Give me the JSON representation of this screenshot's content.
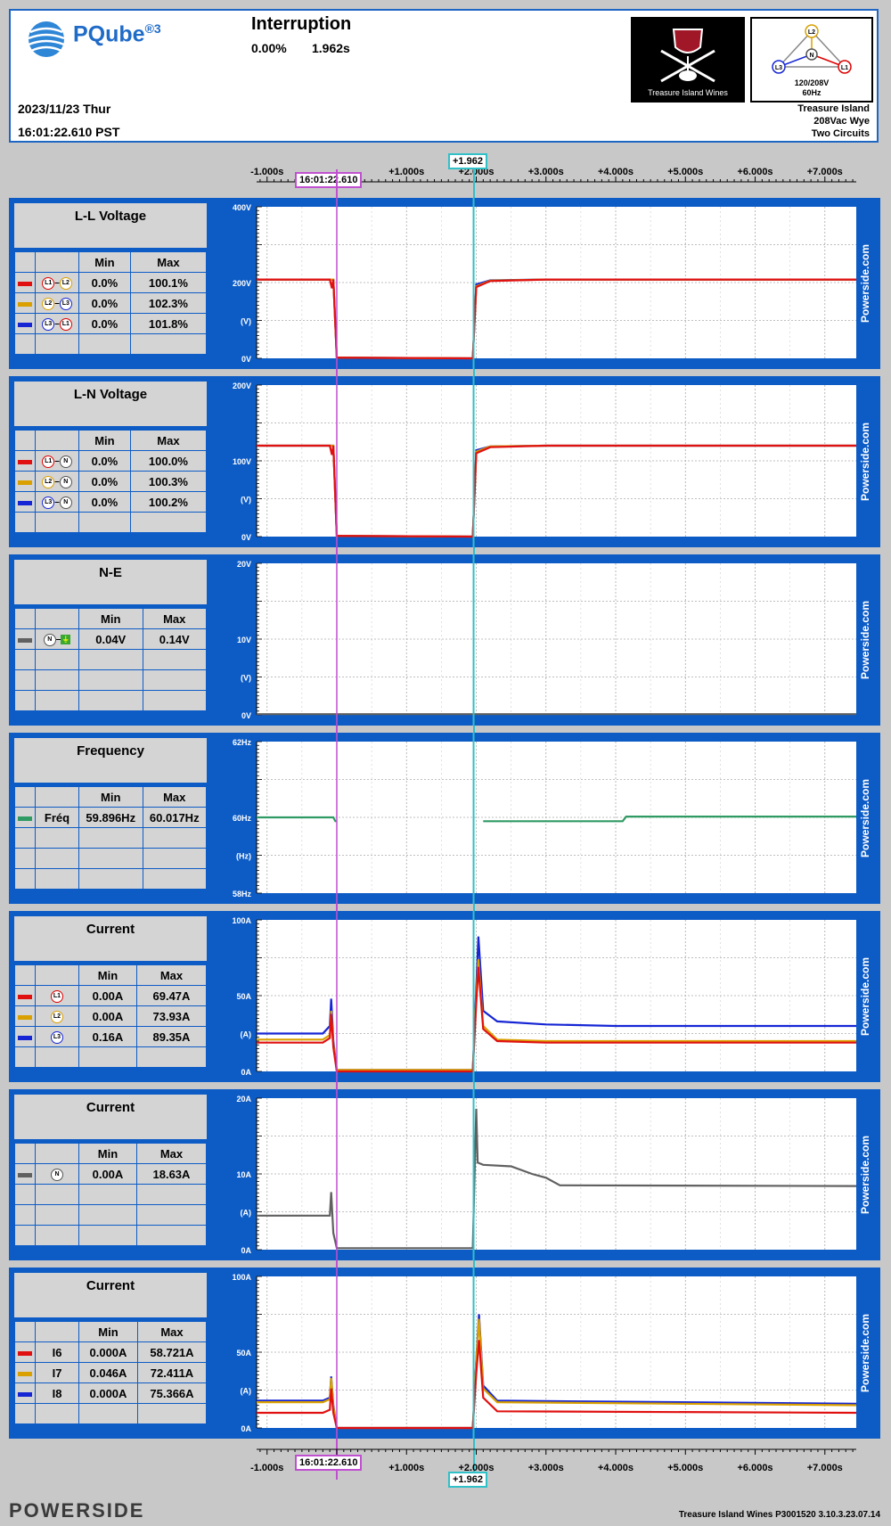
{
  "header": {
    "brand": "PQube",
    "brand_sup": "®3",
    "event_title": "Interruption",
    "event_pct": "0.00%",
    "event_duration": "1.962s",
    "date": "2023/11/23 Thur",
    "time": "16:01:22.610 PST",
    "site_logo_caption": "Treasure Island Wines",
    "phasor_voltage": "120/208V",
    "phasor_freq": "60Hz",
    "site_name": "Treasure Island",
    "site_config": "208Vac Wye",
    "site_circuits": "Two Circuits"
  },
  "markers": {
    "trigger": "16:01:22.610",
    "cursor": "+1.962"
  },
  "side_label": "Powerside.com",
  "legend_cols": {
    "min": "Min",
    "max": "Max"
  },
  "footer": {
    "brand": "POWERSIDE",
    "info": "Treasure Island Wines   P3001520  3.10.3.23.07.14"
  },
  "colors": {
    "red": "#e01010",
    "orange": "#d9a000",
    "blue": "#1626d4",
    "gray": "#606060",
    "green": "#2f9a63",
    "panel": "#0d5cc6",
    "trigger": "#c050d0",
    "cursor": "#30c0c8"
  },
  "chart_data": [
    {
      "type": "line",
      "title": "L-L Voltage",
      "xlim": [
        -1.15,
        7.45
      ],
      "x_ticks": [
        "-1.000s",
        "+1.000s",
        "+2.000s",
        "+3.000s",
        "+4.000s",
        "+5.000s",
        "+6.000s",
        "+7.000s"
      ],
      "y_ticks": [
        "400V",
        "200V",
        "(V)",
        "0V"
      ],
      "ylim": [
        0,
        400
      ],
      "legend": [
        {
          "a": "L1",
          "b": "L2",
          "color": "red",
          "min": "0.0%",
          "max": "100.1%"
        },
        {
          "a": "L2",
          "b": "L3",
          "color": "orange",
          "min": "0.0%",
          "max": "102.3%"
        },
        {
          "a": "L3",
          "b": "L1",
          "color": "blue",
          "min": "0.0%",
          "max": "101.8%"
        }
      ],
      "series": [
        {
          "color": "blue",
          "x": [
            -1.15,
            -0.1,
            -0.05,
            0.0,
            1.95,
            2.0,
            2.2,
            3.0,
            7.45
          ],
          "y": [
            208,
            208,
            208,
            2,
            0,
            195,
            206,
            208,
            208
          ]
        },
        {
          "color": "orange",
          "x": [
            -1.15,
            -0.1,
            -0.05,
            0.0,
            1.95,
            2.0,
            2.2,
            3.0,
            7.45
          ],
          "y": [
            208,
            208,
            208,
            2,
            0,
            190,
            205,
            208,
            208
          ]
        },
        {
          "color": "red",
          "x": [
            -1.15,
            -0.1,
            -0.07,
            -0.05,
            0.0,
            1.95,
            2.0,
            2.2,
            3.0,
            7.45
          ],
          "y": [
            208,
            208,
            185,
            208,
            2,
            0,
            188,
            204,
            208,
            208
          ]
        }
      ]
    },
    {
      "type": "line",
      "title": "L-N Voltage",
      "xlim": [
        -1.15,
        7.45
      ],
      "y_ticks": [
        "200V",
        "100V",
        "(V)",
        "0V"
      ],
      "ylim": [
        0,
        200
      ],
      "legend": [
        {
          "a": "L1",
          "b": "N",
          "color": "red",
          "min": "0.0%",
          "max": "100.0%"
        },
        {
          "a": "L2",
          "b": "N",
          "color": "orange",
          "min": "0.0%",
          "max": "100.3%"
        },
        {
          "a": "L3",
          "b": "N",
          "color": "blue",
          "min": "0.0%",
          "max": "100.2%"
        }
      ],
      "series": [
        {
          "color": "blue",
          "x": [
            -1.15,
            -0.1,
            -0.05,
            0.0,
            1.95,
            2.0,
            2.2,
            3.0,
            7.45
          ],
          "y": [
            120,
            120,
            120,
            1,
            0,
            114,
            119,
            120,
            120
          ]
        },
        {
          "color": "orange",
          "x": [
            -1.15,
            -0.1,
            -0.05,
            0.0,
            1.95,
            2.0,
            2.2,
            3.0,
            7.45
          ],
          "y": [
            120,
            120,
            120,
            1,
            0,
            112,
            119,
            120,
            120
          ]
        },
        {
          "color": "red",
          "x": [
            -1.15,
            -0.1,
            -0.07,
            -0.05,
            0.0,
            1.95,
            2.0,
            2.2,
            3.0,
            7.45
          ],
          "y": [
            120,
            120,
            108,
            120,
            1,
            0,
            110,
            118,
            120,
            120
          ]
        }
      ]
    },
    {
      "type": "line",
      "title": "N-E",
      "xlim": [
        -1.15,
        7.45
      ],
      "y_ticks": [
        "20V",
        "10V",
        "(V)",
        "0V"
      ],
      "ylim": [
        0,
        20
      ],
      "legend": [
        {
          "a": "N",
          "b": "GND",
          "color": "gray",
          "min": "0.04V",
          "max": "0.14V"
        }
      ],
      "series": [
        {
          "color": "gray",
          "x": [
            -1.15,
            7.45
          ],
          "y": [
            0.1,
            0.1
          ]
        }
      ]
    },
    {
      "type": "line",
      "title": "Frequency",
      "xlim": [
        -1.15,
        7.45
      ],
      "y_ticks": [
        "62Hz",
        "60Hz",
        "(Hz)",
        "58Hz"
      ],
      "ylim": [
        58,
        62
      ],
      "legend": [
        {
          "label": "Fréq",
          "color": "green",
          "min": "59.896Hz",
          "max": "60.017Hz"
        }
      ],
      "series": [
        {
          "color": "green",
          "x": [
            -1.15,
            -0.05,
            -0.02,
            0.0
          ],
          "y": [
            60.0,
            60.0,
            59.9,
            59.9
          ]
        },
        {
          "color": "green",
          "x": [
            2.1,
            3.5,
            4.1,
            4.15,
            7.45
          ],
          "y": [
            59.9,
            59.9,
            59.9,
            60.02,
            60.02
          ]
        }
      ]
    },
    {
      "type": "line",
      "title": "Current",
      "xlim": [
        -1.15,
        7.45
      ],
      "y_ticks": [
        "100A",
        "50A",
        "(A)",
        "0A"
      ],
      "ylim": [
        0,
        100
      ],
      "legend": [
        {
          "a": "L1",
          "color": "red",
          "min": "0.00A",
          "max": "69.47A"
        },
        {
          "a": "L2",
          "color": "orange",
          "min": "0.00A",
          "max": "73.93A"
        },
        {
          "a": "L3",
          "color": "blue",
          "min": "0.16A",
          "max": "89.35A"
        }
      ],
      "series": [
        {
          "color": "blue",
          "x": [
            -1.15,
            -0.2,
            -0.1,
            -0.08,
            -0.05,
            0.0,
            1.95,
            2.0,
            2.03,
            2.1,
            2.3,
            3.0,
            4.0,
            7.45
          ],
          "y": [
            25,
            25,
            30,
            48,
            20,
            1,
            1,
            55,
            89,
            40,
            33,
            31,
            30,
            30
          ]
        },
        {
          "color": "orange",
          "x": [
            -1.15,
            -0.2,
            -0.1,
            -0.08,
            -0.05,
            0.0,
            1.95,
            2.0,
            2.03,
            2.1,
            2.3,
            3.0,
            7.45
          ],
          "y": [
            21,
            21,
            24,
            40,
            18,
            1,
            1,
            50,
            74,
            30,
            21,
            20,
            20
          ]
        },
        {
          "color": "red",
          "x": [
            -1.15,
            -0.2,
            -0.1,
            -0.08,
            -0.05,
            0.0,
            1.95,
            2.0,
            2.03,
            2.1,
            2.3,
            3.0,
            7.45
          ],
          "y": [
            19,
            19,
            22,
            38,
            16,
            0,
            0,
            45,
            69,
            28,
            20,
            19,
            19
          ]
        }
      ]
    },
    {
      "type": "line",
      "title": "Current",
      "xlim": [
        -1.15,
        7.45
      ],
      "y_ticks": [
        "20A",
        "10A",
        "(A)",
        "0A"
      ],
      "ylim": [
        0,
        20
      ],
      "legend": [
        {
          "a": "N",
          "color": "gray",
          "min": "0.00A",
          "max": "18.63A"
        }
      ],
      "series": [
        {
          "color": "gray",
          "x": [
            -1.15,
            -0.1,
            -0.08,
            -0.05,
            0.0,
            1.95,
            2.0,
            2.02,
            2.1,
            2.5,
            2.8,
            3.0,
            3.2,
            7.45
          ],
          "y": [
            4.5,
            4.5,
            7.6,
            2.2,
            0.2,
            0.2,
            18.6,
            11.5,
            11.2,
            11.0,
            10.0,
            9.5,
            8.5,
            8.4
          ]
        }
      ]
    },
    {
      "type": "line",
      "title": "Current",
      "xlim": [
        -1.15,
        7.45
      ],
      "y_ticks": [
        "100A",
        "50A",
        "(A)",
        "0A"
      ],
      "ylim": [
        0,
        100
      ],
      "legend": [
        {
          "label": "I6",
          "color": "red",
          "min": "0.000A",
          "max": "58.721A"
        },
        {
          "label": "I7",
          "color": "orange",
          "min": "0.046A",
          "max": "72.411A"
        },
        {
          "label": "I8",
          "color": "blue",
          "min": "0.000A",
          "max": "75.366A"
        }
      ],
      "series": [
        {
          "color": "blue",
          "x": [
            -1.15,
            -0.2,
            -0.1,
            -0.08,
            -0.05,
            0.0,
            1.95,
            2.0,
            2.04,
            2.1,
            2.3,
            7.45
          ],
          "y": [
            18,
            18,
            20,
            34,
            15,
            0,
            0,
            45,
            75,
            28,
            18,
            16
          ]
        },
        {
          "color": "orange",
          "x": [
            -1.15,
            -0.2,
            -0.1,
            -0.08,
            -0.05,
            0.0,
            1.95,
            2.0,
            2.04,
            2.1,
            2.3,
            7.45
          ],
          "y": [
            17,
            17,
            19,
            33,
            14,
            0,
            0,
            44,
            72,
            26,
            17,
            15
          ]
        },
        {
          "color": "red",
          "x": [
            -1.15,
            -0.2,
            -0.1,
            -0.08,
            -0.05,
            0.0,
            1.95,
            2.0,
            2.04,
            2.1,
            2.3,
            7.45
          ],
          "y": [
            10,
            10,
            12,
            26,
            10,
            0,
            0,
            36,
            58,
            20,
            11,
            10
          ]
        }
      ]
    }
  ]
}
